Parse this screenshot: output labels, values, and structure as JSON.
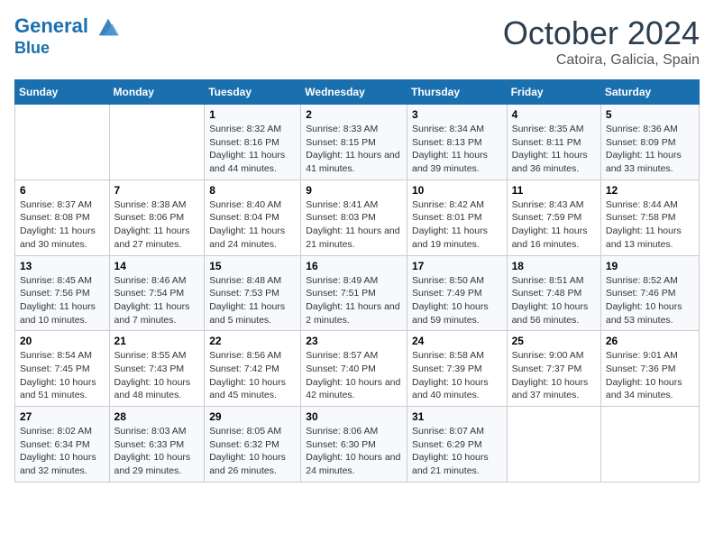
{
  "header": {
    "logo_line1": "General",
    "logo_line2": "Blue",
    "month": "October 2024",
    "location": "Catoira, Galicia, Spain"
  },
  "days_of_week": [
    "Sunday",
    "Monday",
    "Tuesday",
    "Wednesday",
    "Thursday",
    "Friday",
    "Saturday"
  ],
  "weeks": [
    [
      {
        "day": "",
        "info": ""
      },
      {
        "day": "",
        "info": ""
      },
      {
        "day": "1",
        "info": "Sunrise: 8:32 AM\nSunset: 8:16 PM\nDaylight: 11 hours and 44 minutes."
      },
      {
        "day": "2",
        "info": "Sunrise: 8:33 AM\nSunset: 8:15 PM\nDaylight: 11 hours and 41 minutes."
      },
      {
        "day": "3",
        "info": "Sunrise: 8:34 AM\nSunset: 8:13 PM\nDaylight: 11 hours and 39 minutes."
      },
      {
        "day": "4",
        "info": "Sunrise: 8:35 AM\nSunset: 8:11 PM\nDaylight: 11 hours and 36 minutes."
      },
      {
        "day": "5",
        "info": "Sunrise: 8:36 AM\nSunset: 8:09 PM\nDaylight: 11 hours and 33 minutes."
      }
    ],
    [
      {
        "day": "6",
        "info": "Sunrise: 8:37 AM\nSunset: 8:08 PM\nDaylight: 11 hours and 30 minutes."
      },
      {
        "day": "7",
        "info": "Sunrise: 8:38 AM\nSunset: 8:06 PM\nDaylight: 11 hours and 27 minutes."
      },
      {
        "day": "8",
        "info": "Sunrise: 8:40 AM\nSunset: 8:04 PM\nDaylight: 11 hours and 24 minutes."
      },
      {
        "day": "9",
        "info": "Sunrise: 8:41 AM\nSunset: 8:03 PM\nDaylight: 11 hours and 21 minutes."
      },
      {
        "day": "10",
        "info": "Sunrise: 8:42 AM\nSunset: 8:01 PM\nDaylight: 11 hours and 19 minutes."
      },
      {
        "day": "11",
        "info": "Sunrise: 8:43 AM\nSunset: 7:59 PM\nDaylight: 11 hours and 16 minutes."
      },
      {
        "day": "12",
        "info": "Sunrise: 8:44 AM\nSunset: 7:58 PM\nDaylight: 11 hours and 13 minutes."
      }
    ],
    [
      {
        "day": "13",
        "info": "Sunrise: 8:45 AM\nSunset: 7:56 PM\nDaylight: 11 hours and 10 minutes."
      },
      {
        "day": "14",
        "info": "Sunrise: 8:46 AM\nSunset: 7:54 PM\nDaylight: 11 hours and 7 minutes."
      },
      {
        "day": "15",
        "info": "Sunrise: 8:48 AM\nSunset: 7:53 PM\nDaylight: 11 hours and 5 minutes."
      },
      {
        "day": "16",
        "info": "Sunrise: 8:49 AM\nSunset: 7:51 PM\nDaylight: 11 hours and 2 minutes."
      },
      {
        "day": "17",
        "info": "Sunrise: 8:50 AM\nSunset: 7:49 PM\nDaylight: 10 hours and 59 minutes."
      },
      {
        "day": "18",
        "info": "Sunrise: 8:51 AM\nSunset: 7:48 PM\nDaylight: 10 hours and 56 minutes."
      },
      {
        "day": "19",
        "info": "Sunrise: 8:52 AM\nSunset: 7:46 PM\nDaylight: 10 hours and 53 minutes."
      }
    ],
    [
      {
        "day": "20",
        "info": "Sunrise: 8:54 AM\nSunset: 7:45 PM\nDaylight: 10 hours and 51 minutes."
      },
      {
        "day": "21",
        "info": "Sunrise: 8:55 AM\nSunset: 7:43 PM\nDaylight: 10 hours and 48 minutes."
      },
      {
        "day": "22",
        "info": "Sunrise: 8:56 AM\nSunset: 7:42 PM\nDaylight: 10 hours and 45 minutes."
      },
      {
        "day": "23",
        "info": "Sunrise: 8:57 AM\nSunset: 7:40 PM\nDaylight: 10 hours and 42 minutes."
      },
      {
        "day": "24",
        "info": "Sunrise: 8:58 AM\nSunset: 7:39 PM\nDaylight: 10 hours and 40 minutes."
      },
      {
        "day": "25",
        "info": "Sunrise: 9:00 AM\nSunset: 7:37 PM\nDaylight: 10 hours and 37 minutes."
      },
      {
        "day": "26",
        "info": "Sunrise: 9:01 AM\nSunset: 7:36 PM\nDaylight: 10 hours and 34 minutes."
      }
    ],
    [
      {
        "day": "27",
        "info": "Sunrise: 8:02 AM\nSunset: 6:34 PM\nDaylight: 10 hours and 32 minutes."
      },
      {
        "day": "28",
        "info": "Sunrise: 8:03 AM\nSunset: 6:33 PM\nDaylight: 10 hours and 29 minutes."
      },
      {
        "day": "29",
        "info": "Sunrise: 8:05 AM\nSunset: 6:32 PM\nDaylight: 10 hours and 26 minutes."
      },
      {
        "day": "30",
        "info": "Sunrise: 8:06 AM\nSunset: 6:30 PM\nDaylight: 10 hours and 24 minutes."
      },
      {
        "day": "31",
        "info": "Sunrise: 8:07 AM\nSunset: 6:29 PM\nDaylight: 10 hours and 21 minutes."
      },
      {
        "day": "",
        "info": ""
      },
      {
        "day": "",
        "info": ""
      }
    ]
  ]
}
